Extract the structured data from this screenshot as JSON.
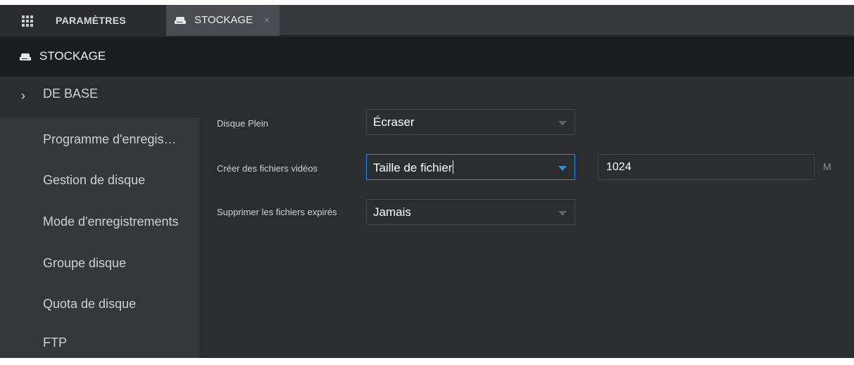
{
  "tabs": {
    "settings_label": "PARAMÈTRES",
    "storage_label": "STOCKAGE",
    "close_glyph": "×"
  },
  "header": {
    "title": "STOCKAGE"
  },
  "sidebar": {
    "items": [
      {
        "label": "DE BASE",
        "active": true
      },
      {
        "label": "Programme d'enregis…"
      },
      {
        "label": "Gestion de disque"
      },
      {
        "label": "Mode d'enregistrements"
      },
      {
        "label": "Groupe disque"
      },
      {
        "label": "Quota de disque"
      },
      {
        "label": "FTP"
      }
    ]
  },
  "form": {
    "disk_full": {
      "label": "Disque Plein",
      "value": "Écraser"
    },
    "create_files": {
      "label": "Créer des fichiers vidéos",
      "value": "Taille de fichier",
      "size_value": "1024",
      "unit": "M"
    },
    "delete_expired": {
      "label": "Supprimer les fichiers expirés",
      "value": "Jamais"
    }
  },
  "colors": {
    "accent": "#2b8ee0",
    "background": "#2b2d31",
    "sidebar": "#35373b",
    "header": "#1c1d20"
  }
}
